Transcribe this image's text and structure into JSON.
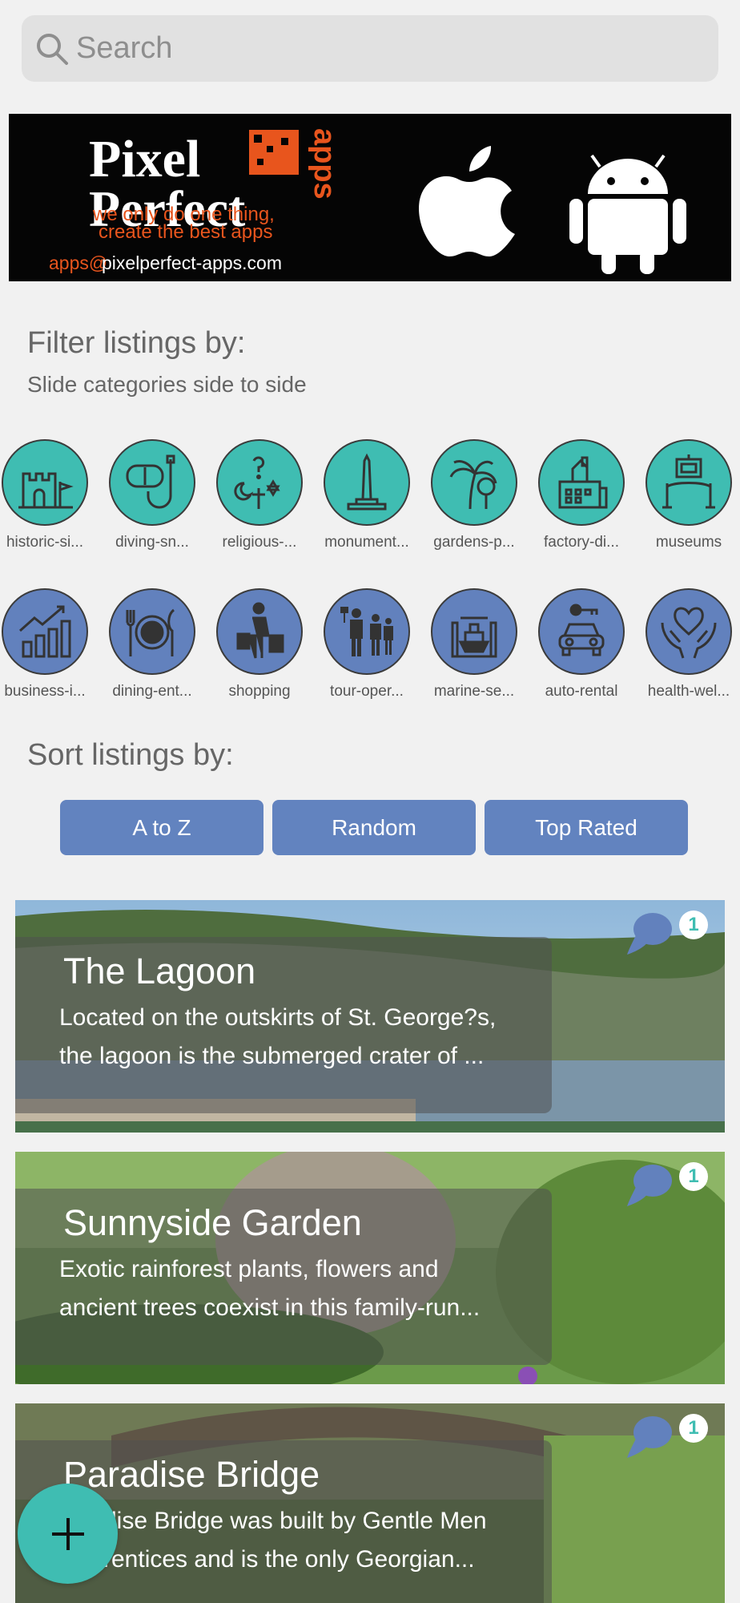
{
  "search": {
    "placeholder": "Search"
  },
  "banner": {
    "brand_line1": "Pixel",
    "brand_line2": "Perfect",
    "brand_vertical": "apps",
    "tagline_line1": "we only do one thing,",
    "tagline_line2": "create the best apps",
    "email_prefix": "apps@",
    "email_domain": "pixelperfect-apps.com"
  },
  "filter": {
    "title": "Filter listings by:",
    "subtitle": "Slide categories side to side",
    "row1": [
      {
        "label": "historic-si...",
        "icon": "castle-icon"
      },
      {
        "label": "diving-sn...",
        "icon": "snorkel-icon"
      },
      {
        "label": "religious-...",
        "icon": "religious-symbols-icon"
      },
      {
        "label": "monument...",
        "icon": "monument-icon"
      },
      {
        "label": "gardens-p...",
        "icon": "palm-tree-icon"
      },
      {
        "label": "factory-di...",
        "icon": "factory-icon"
      },
      {
        "label": "museums",
        "icon": "museum-exhibit-icon"
      }
    ],
    "row2": [
      {
        "label": "business-i...",
        "icon": "growth-chart-icon"
      },
      {
        "label": "dining-ent...",
        "icon": "plate-cutlery-icon"
      },
      {
        "label": "shopping",
        "icon": "shopper-bags-icon"
      },
      {
        "label": "tour-oper...",
        "icon": "tour-group-icon"
      },
      {
        "label": "marine-se...",
        "icon": "boat-icon"
      },
      {
        "label": "auto-rental",
        "icon": "car-key-icon"
      },
      {
        "label": "health-wel...",
        "icon": "hands-heart-icon"
      }
    ]
  },
  "sort": {
    "title": "Sort listings by:",
    "buttons": [
      "A to Z",
      "Random",
      "Top Rated"
    ]
  },
  "listings": [
    {
      "title": "The Lagoon",
      "desc_line1": "Located on the outskirts of St. George?s,",
      "desc_line2": "the lagoon is the submerged crater of ...",
      "comments": "1"
    },
    {
      "title": "Sunnyside Garden",
      "desc_line1": "Exotic rainforest plants, flowers and",
      "desc_line2": "ancient trees coexist in this family-run...",
      "comments": "1"
    },
    {
      "title": "Paradise Bridge",
      "desc_line1": "dise Bridge was built by Gentle Men",
      "desc_line2": "rentices and is the only Georgian...",
      "comments": "1"
    }
  ],
  "colors": {
    "teal": "#3fbdb2",
    "blue": "#6281bd",
    "banner_orange": "#e8551d"
  }
}
